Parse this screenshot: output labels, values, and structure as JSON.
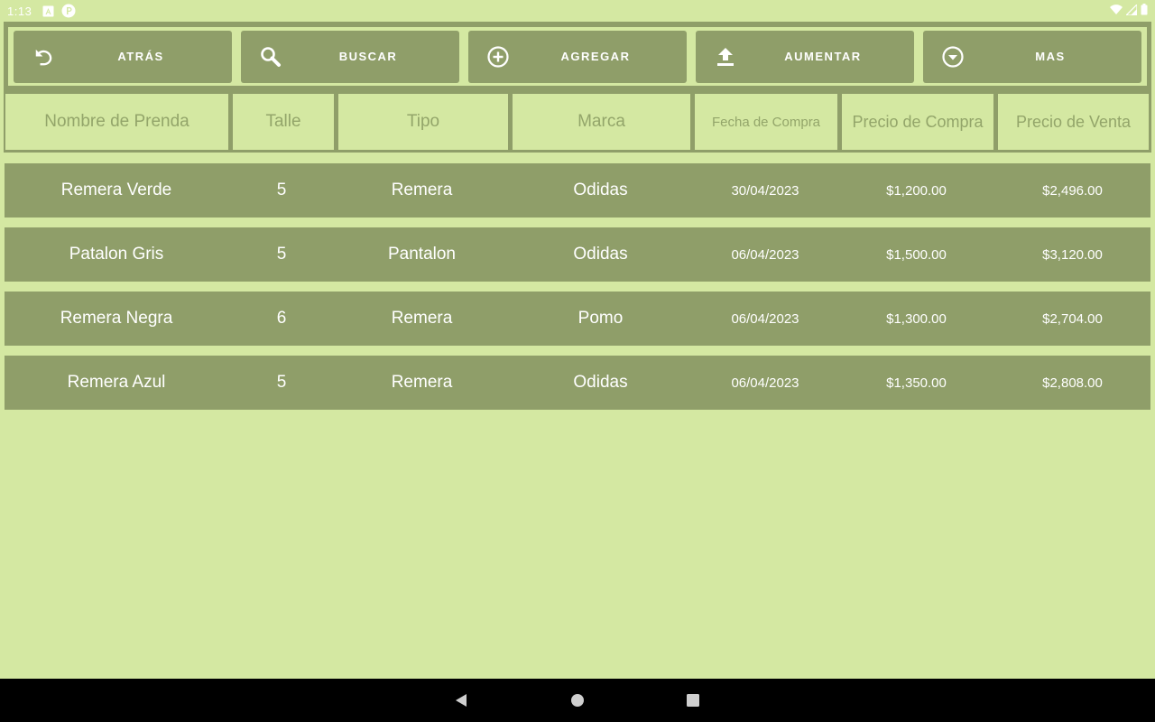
{
  "status": {
    "time": "1:13",
    "icons": [
      "notification-a-icon",
      "notification-p-icon",
      "wifi-icon",
      "signal-icon",
      "battery-icon"
    ]
  },
  "toolbar": {
    "back_label": "ATRÁS",
    "search_label": "BUSCAR",
    "add_label": "AGREGAR",
    "increase_label": "AUMENTAR",
    "more_label": "MAS"
  },
  "table": {
    "headers": [
      "Nombre de Prenda",
      "Talle",
      "Tipo",
      "Marca",
      "Fecha de Compra",
      "Precio de Compra",
      "Precio de Venta"
    ],
    "rows": [
      [
        "Remera Verde",
        "5",
        "Remera",
        "Odidas",
        "30/04/2023",
        "$1,200.00",
        "$2,496.00"
      ],
      [
        "Patalon Gris",
        "5",
        "Pantalon",
        "Odidas",
        "06/04/2023",
        "$1,500.00",
        "$3,120.00"
      ],
      [
        "Remera Negra",
        "6",
        "Remera",
        "Pomo",
        "06/04/2023",
        "$1,300.00",
        "$2,704.00"
      ],
      [
        "Remera Azul",
        "5",
        "Remera",
        "Odidas",
        "06/04/2023",
        "$1,350.00",
        "$2,808.00"
      ]
    ]
  },
  "colors": {
    "background": "#d4e8a2",
    "accent": "#8f9e69",
    "header_text": "#93a56a",
    "text": "#ffffff"
  }
}
